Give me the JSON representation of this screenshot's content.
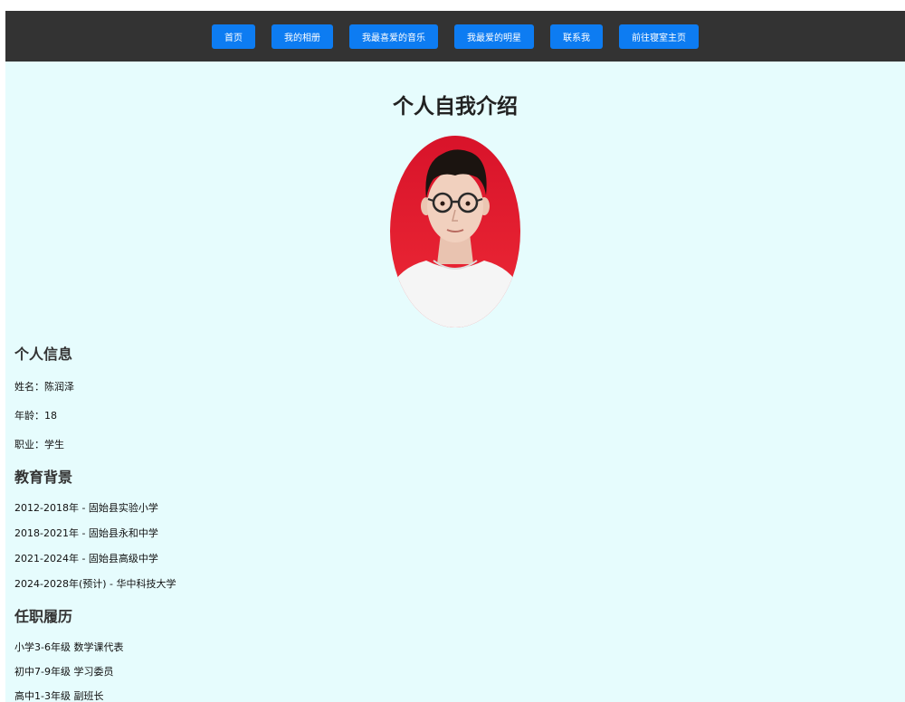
{
  "nav": {
    "items": [
      "首页",
      "我的相册",
      "我最喜爱的音乐",
      "我最爱的明星",
      "联系我",
      "前往寝室主页"
    ]
  },
  "page": {
    "title": "个人自我介绍"
  },
  "personal_info": {
    "heading": "个人信息",
    "name": "姓名：陈润泽",
    "age": "年龄：18",
    "job": "职业：学生"
  },
  "education": {
    "heading": "教育背景",
    "items": [
      "2012-2018年 - 固始县实验小学",
      "2018-2021年 - 固始县永和中学",
      "2021-2024年 - 固始县高级中学",
      "2024-2028年(预计) - 华中科技大学"
    ]
  },
  "positions": {
    "heading": "任职履历",
    "items": [
      "小学3-6年级 数学课代表",
      "初中7-9年级 学习委员",
      "高中1-3年级 副班长"
    ]
  },
  "colors": {
    "nav_bg": "#333333",
    "nav_button": "#0d7cf2",
    "page_bg": "#e6fcfd",
    "portrait_bg": "#e21b2c"
  }
}
